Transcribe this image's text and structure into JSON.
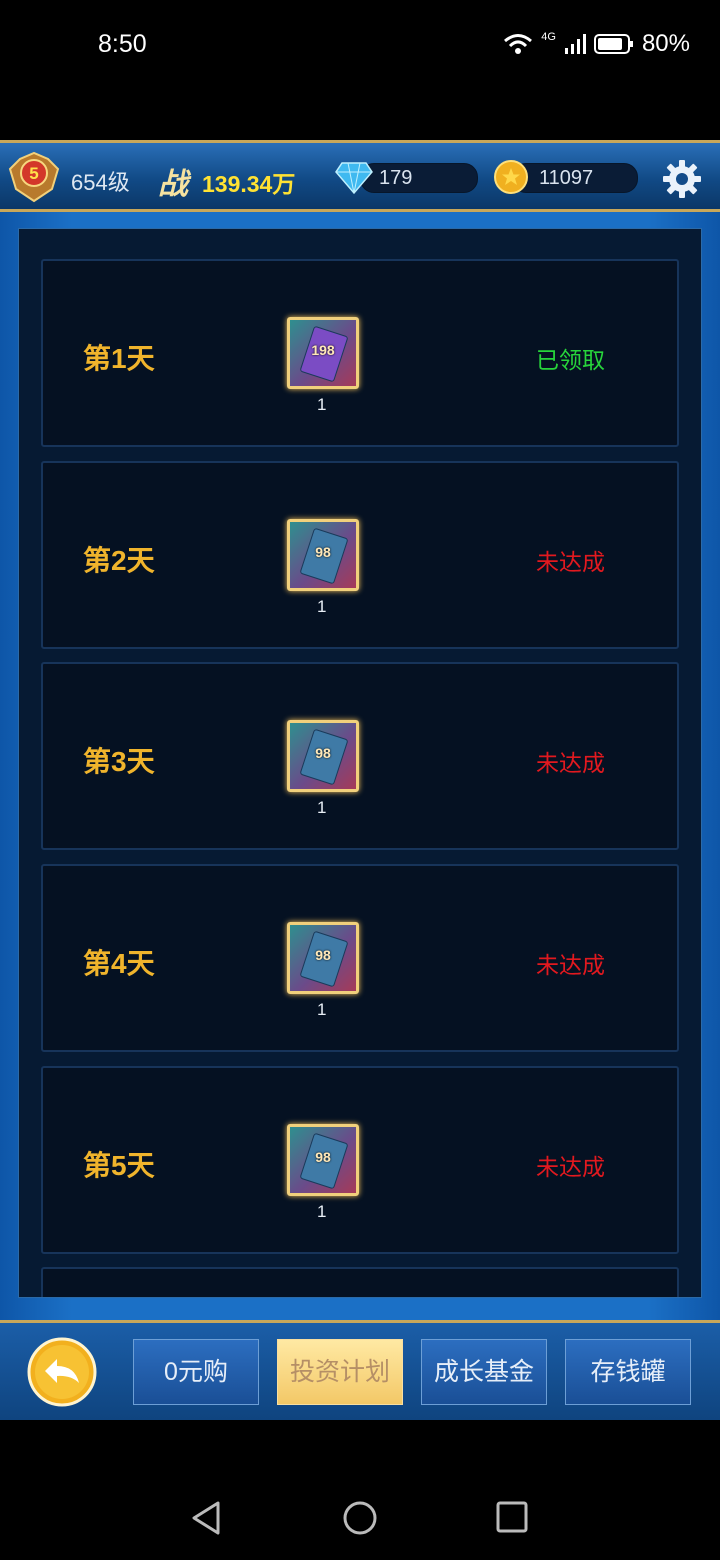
{
  "status_bar": {
    "time": "8:50",
    "network": "4G",
    "battery": "80%"
  },
  "top_bar": {
    "rank_badge": "5",
    "level": "654级",
    "power_icon": "战",
    "power_value": "139.34万",
    "diamonds": "179",
    "coins": "11097"
  },
  "rewards": [
    {
      "day": "第1天",
      "card_value": "198",
      "quantity": "1",
      "status": "已领取"
    },
    {
      "day": "第2天",
      "card_value": "98",
      "quantity": "1",
      "status": "未达成"
    },
    {
      "day": "第3天",
      "card_value": "98",
      "quantity": "1",
      "status": "未达成"
    },
    {
      "day": "第4天",
      "card_value": "98",
      "quantity": "1",
      "status": "未达成"
    },
    {
      "day": "第5天",
      "card_value": "98",
      "quantity": "1",
      "status": "未达成"
    }
  ],
  "tabs": [
    {
      "label": "0元购"
    },
    {
      "label": "投资计划"
    },
    {
      "label": "成长基金"
    },
    {
      "label": "存钱罐"
    }
  ],
  "colors": {
    "claimed": "#27d43b",
    "pending": "#e2191f",
    "day_label": "#f0b42c",
    "power_value": "#ffe233",
    "active_tab": "#f3c867"
  }
}
